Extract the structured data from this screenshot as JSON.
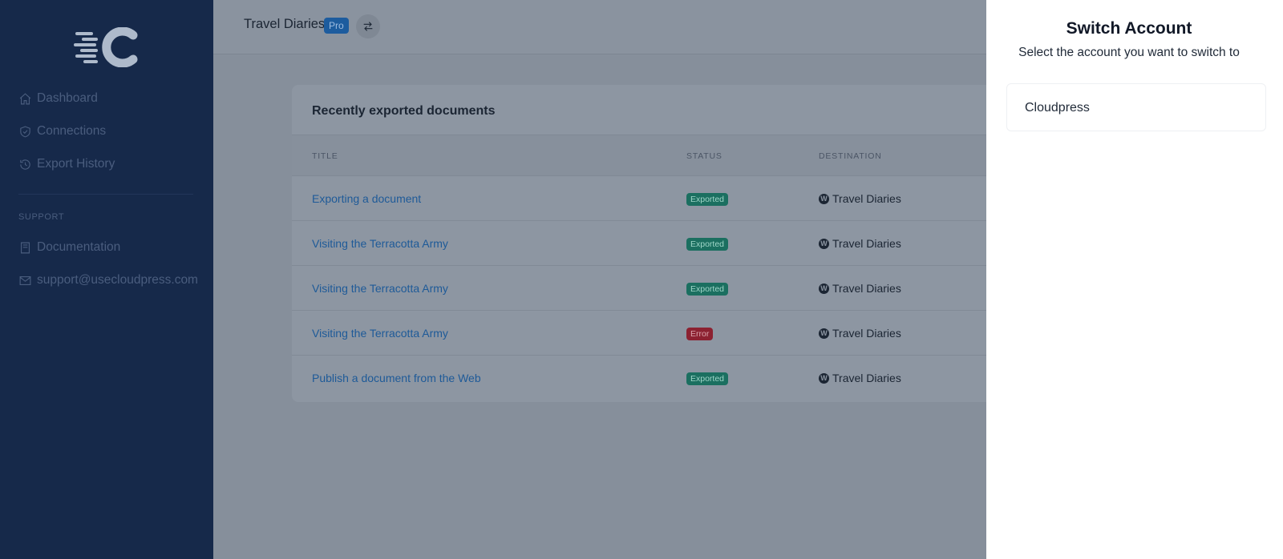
{
  "sidebar": {
    "logo_alt": "Cloudpress logo",
    "nav": [
      {
        "label": "Dashboard",
        "icon": "home-icon"
      },
      {
        "label": "Connections",
        "icon": "shield-check-icon"
      },
      {
        "label": "Export History",
        "icon": "history-icon"
      }
    ],
    "support_heading": "SUPPORT",
    "support": [
      {
        "label": "Documentation",
        "icon": "book-icon"
      },
      {
        "label": "support@usecloudpress.com",
        "icon": "mail-icon"
      }
    ]
  },
  "header": {
    "site_name": "Travel Diaries",
    "plan_badge": "Pro",
    "switch_icon": "switch-arrows-icon"
  },
  "card": {
    "title": "Recently exported documents",
    "columns": [
      "TITLE",
      "STATUS",
      "DESTINATION"
    ],
    "rows": [
      {
        "title": "Exporting a document",
        "status": "Exported",
        "destination": "Travel Diaries"
      },
      {
        "title": "Visiting the Terracotta Army",
        "status": "Exported",
        "destination": "Travel Diaries"
      },
      {
        "title": "Visiting the Terracotta Army",
        "status": "Exported",
        "destination": "Travel Diaries"
      },
      {
        "title": "Visiting the Terracotta Army",
        "status": "Error",
        "destination": "Travel Diaries"
      },
      {
        "title": "Publish a document from the Web",
        "status": "Exported",
        "destination": "Travel Diaries"
      }
    ]
  },
  "panel": {
    "title": "Switch Account",
    "subtitle": "Select the account you want to switch to",
    "accounts": [
      {
        "name": "Cloudpress"
      }
    ]
  },
  "colors": {
    "sidebar_bg": "#16294a",
    "overlay_bg": "#868f9b",
    "exported_badge": "#1b6f60",
    "error_badge": "#8c2131",
    "link": "#1e5a98"
  }
}
